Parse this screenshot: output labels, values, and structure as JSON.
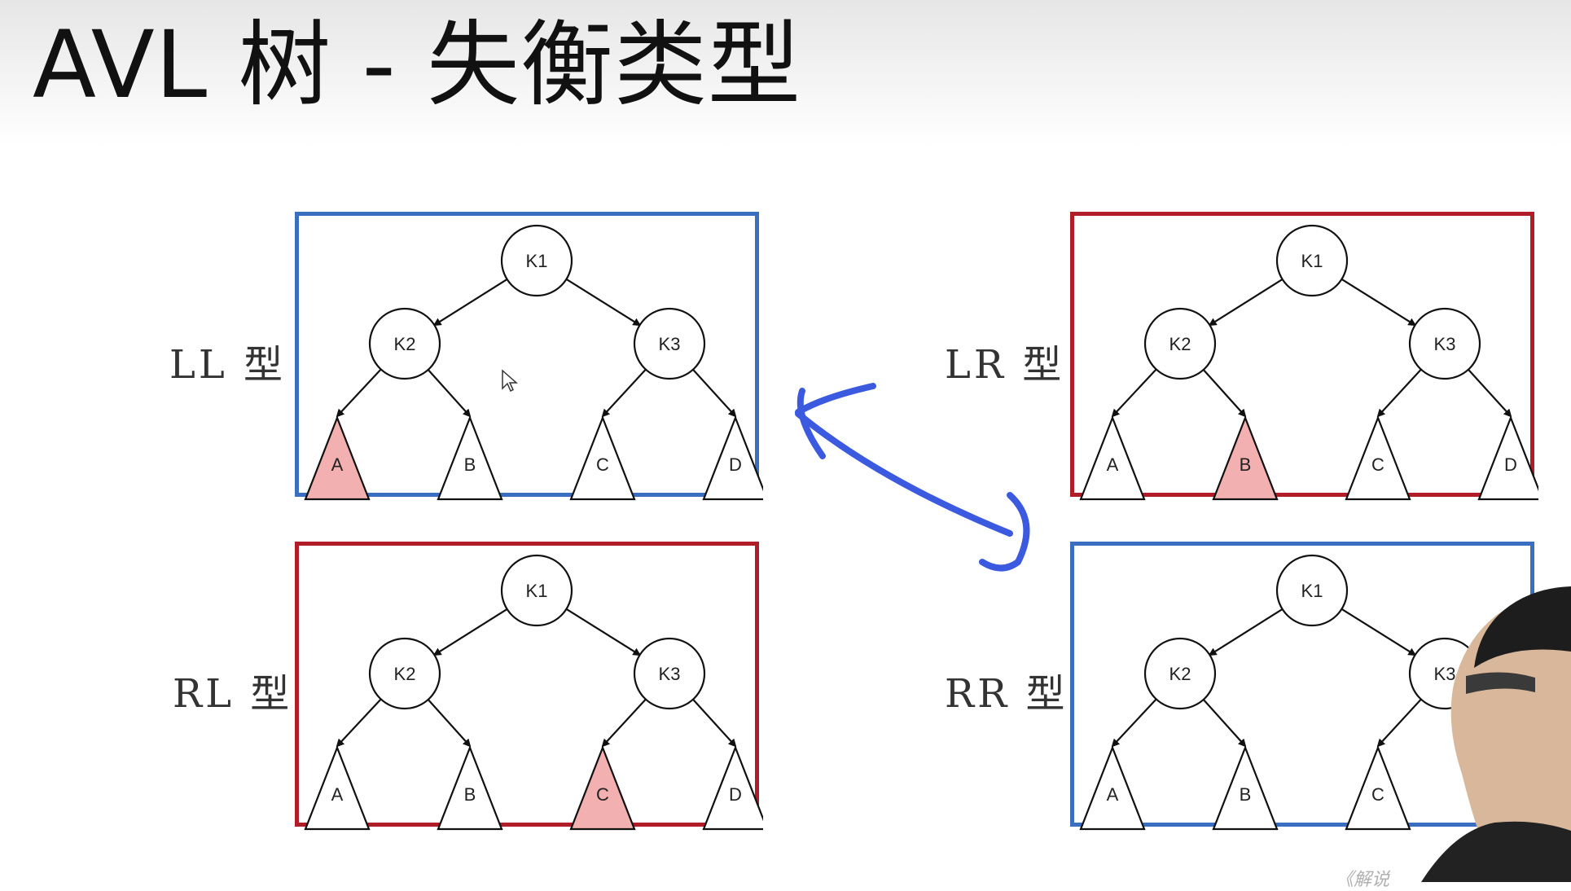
{
  "title": "AVL 树 - 失衡类型",
  "colors": {
    "blue_frame": "#3a6ec0",
    "red_frame": "#b01c27",
    "highlight_fill": "#f2b0b0",
    "annotation_arrow": "#3b5ae0"
  },
  "node_labels": [
    "K1",
    "K2",
    "K3"
  ],
  "subtree_labels": [
    "A",
    "B",
    "C",
    "D"
  ],
  "panels": [
    {
      "id": "ll",
      "label": "LL 型",
      "frame_color": "blue",
      "highlight": "A"
    },
    {
      "id": "lr",
      "label": "LR 型",
      "frame_color": "red",
      "highlight": "B"
    },
    {
      "id": "rl",
      "label": "RL 型",
      "frame_color": "red",
      "highlight": "C"
    },
    {
      "id": "rr",
      "label": "RR 型",
      "frame_color": "blue",
      "highlight": "D"
    }
  ],
  "annotation": {
    "type": "double-headed-arrow",
    "connects": [
      "LL 型",
      "RR 型"
    ],
    "icon": "curved-double-arrow-icon"
  },
  "watermark": "《解说",
  "presenter": {
    "icon": "webcam-presenter-icon"
  }
}
